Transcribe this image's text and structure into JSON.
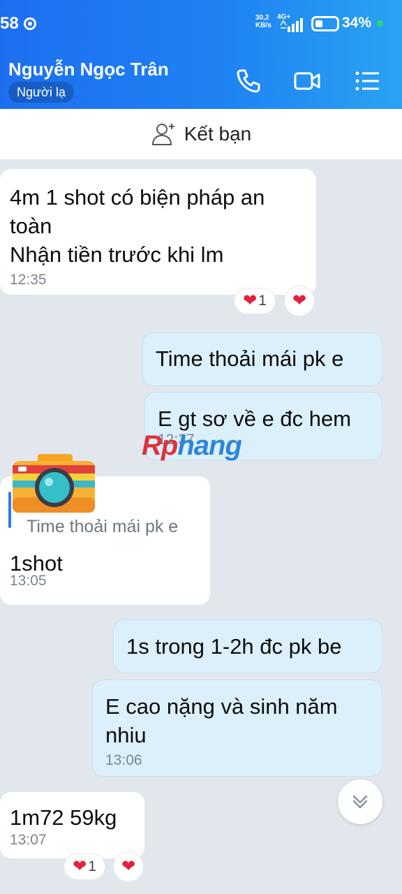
{
  "status_bar": {
    "time": "58",
    "net_speed": "30,2",
    "net_unit": "KB/s",
    "network": "4G+",
    "battery": "34%"
  },
  "header": {
    "contact_name": "Nguyễn Ngọc Trân",
    "badge": "Người lạ",
    "icons": [
      "phone-icon",
      "video-call-icon",
      "menu-list-icon"
    ]
  },
  "add_friend": {
    "label": "Kết bạn",
    "icon": "add-user-icon"
  },
  "messages": [
    {
      "side": "in",
      "text": "4m 1 shot có biện pháp an\ntoàn\nNhận tiền trước khi lm",
      "time": "12:35",
      "reaction_count": "1"
    },
    {
      "side": "out",
      "text": "Time thoải mái pk e"
    },
    {
      "side": "out",
      "text": "E gt sơ về e đc hem",
      "time": "12:37"
    },
    {
      "side": "in",
      "quote": "Time thoải mái pk e",
      "text": "1shot",
      "time": "13:05"
    },
    {
      "side": "out",
      "text": "1s trong 1-2h đc pk be"
    },
    {
      "side": "out",
      "text": "E cao nặng và sinh năm\nnhiu",
      "time": "13:06"
    },
    {
      "side": "in",
      "text": "1m72 59kg",
      "time": "13:07",
      "reaction_count": "1"
    }
  ],
  "watermark": {
    "part1": "Rp",
    "part2": "hang"
  },
  "colors": {
    "header_start": "#1d6ff0",
    "header_end": "#2aa2f2",
    "bg": "#e2e7ee",
    "outgoing": "#dcf0fc",
    "heart": "#e3203b"
  }
}
